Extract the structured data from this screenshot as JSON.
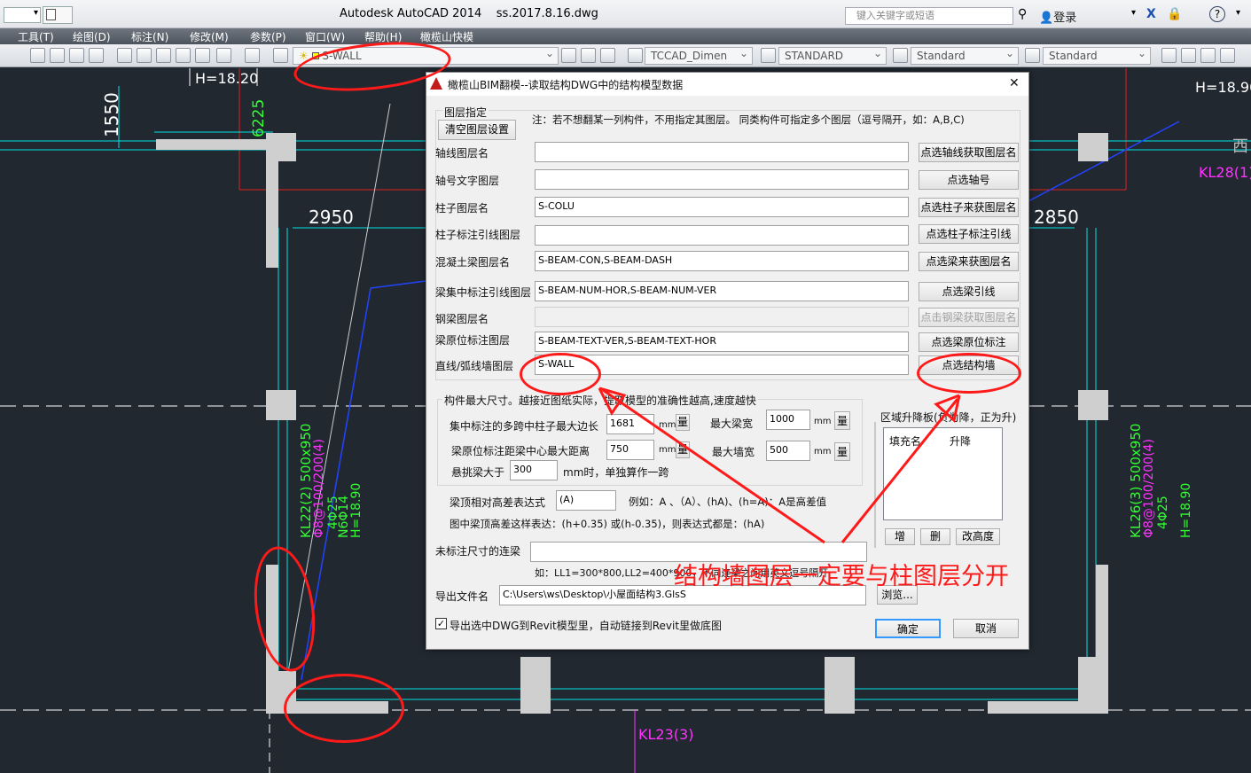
{
  "window": {
    "app": "Autodesk AutoCAD 2014",
    "file": "ss.2017.8.16.dwg",
    "search_placeholder": "键入关键字或短语",
    "login": "登录"
  },
  "menu": [
    "工具(T)",
    "绘图(D)",
    "标注(N)",
    "修改(M)",
    "参数(P)",
    "窗口(W)",
    "帮助(H)",
    "橄榄山快模"
  ],
  "toolbar": {
    "layer": "S-WALL",
    "dim_style": "TCCAD_Dimen",
    "text_style": "STANDARD",
    "table_style": "Standard",
    "mleader_style": "Standard"
  },
  "drawing": {
    "dims": [
      "1550",
      "2950",
      "2850",
      "6225",
      "H=18.20",
      "H=18.90"
    ],
    "beams": [
      "KL28(1)",
      "KL23(3)",
      "KL22(2) 500x950",
      "KL26(3) 500x950",
      "Φ8@100/200(4)",
      "4Φ25",
      "N6Φ14",
      "H=18.90"
    ],
    "side_text": "西"
  },
  "dialog": {
    "title": "橄榄山BIM翻模--读取结构DWG中的结构模型数据",
    "close": "✕",
    "group_layers": "图层指定",
    "clear_btn": "清空图层设置",
    "note": "注：若不想翻某一列构件，不用指定其图层。 同类构件可指定多个图层（逗号隔开，如：A,B,C)",
    "rows": [
      {
        "label": "轴线图层名",
        "value": "",
        "btn": "点选轴线获取图层名",
        "disabled": false
      },
      {
        "label": "轴号文字图层",
        "value": "",
        "btn": "点选轴号",
        "disabled": false
      },
      {
        "label": "柱子图层名",
        "value": "S-COLU",
        "btn": "点选柱子来获图层名",
        "disabled": false
      },
      {
        "label": "柱子标注引线图层",
        "value": "",
        "btn": "点选柱子标注引线",
        "disabled": false
      },
      {
        "label": "混凝土梁图层名",
        "value": "S-BEAM-CON,S-BEAM-DASH",
        "btn": "点选梁来获图层名",
        "disabled": false
      },
      {
        "label": "梁集中标注引线图层",
        "value": "S-BEAM-NUM-HOR,S-BEAM-NUM-VER",
        "btn": "点选梁引线",
        "disabled": false
      },
      {
        "label": "钢梁图层名",
        "value": "",
        "btn": "点击钢梁获取图层名",
        "disabled": true
      },
      {
        "label": "梁原位标注图层",
        "value": "S-BEAM-TEXT-VER,S-BEAM-TEXT-HOR",
        "btn": "点选梁原位标注",
        "disabled": false
      },
      {
        "label": "直线/弧线墙图层",
        "value": "S-WALL",
        "btn": "点选结构墙",
        "disabled": false
      }
    ],
    "group_size": "构件最大尺寸。越接近图纸实际，提取模型的准确性越高,速度越快",
    "size_rows": [
      {
        "label": "集中标注的多跨中柱子最大边长",
        "value": "1681",
        "unit": "mm",
        "btn": "量"
      },
      {
        "label": "梁原位标注距梁中心最大距离",
        "value": "750",
        "unit": "mm",
        "btn": "量"
      },
      {
        "label": "最大梁宽",
        "value": "1000",
        "unit": "mm",
        "btn": "量"
      },
      {
        "label": "最大墙宽",
        "value": "500",
        "unit": "mm",
        "btn": "量"
      }
    ],
    "cantilever_label": "悬挑梁大于",
    "cantilever_value": "300",
    "cantilever_suffix": "mm时，单独算作一跨",
    "region_title": "区域升降板(负为降，正为升)",
    "region_cols": [
      "填充名",
      "升降"
    ],
    "region_btns": [
      "增",
      "删",
      "改高度"
    ],
    "beam_expr_label": "梁顶相对高差表达式",
    "beam_expr_value": "(A)",
    "beam_expr_example": "例如：A 、（A）、(hA)、(h=A)：A是高差值",
    "beam_expr_note": "图中梁顶高差这样表达：(h+0.35) 或(h-0.35)，则表达式都是：(hA)",
    "link_beam_label": "未标注尺寸的连梁",
    "link_beam_value": "",
    "link_beam_note": "如：LL1=300*800,LL2=400*900，不同连梁之间用英文逗号隔开",
    "export_label": "导出文件名",
    "export_value": "C:\\Users\\ws\\Desktop\\小屋面结构3.GlsS",
    "browse": "浏览...",
    "checkbox": "导出选中DWG到Revit模型里，自动链接到Revit里做底图",
    "ok": "确定",
    "cancel": "取消"
  },
  "annotation": "结构墙图层一定要与柱图层分开",
  "colors": {
    "annotation": "#ff1a1a",
    "cad_bg": "#212830",
    "column": "#d9d9d9",
    "axis": "#00e5e5",
    "magenta": "#ff33ff",
    "green": "#33ff33"
  }
}
